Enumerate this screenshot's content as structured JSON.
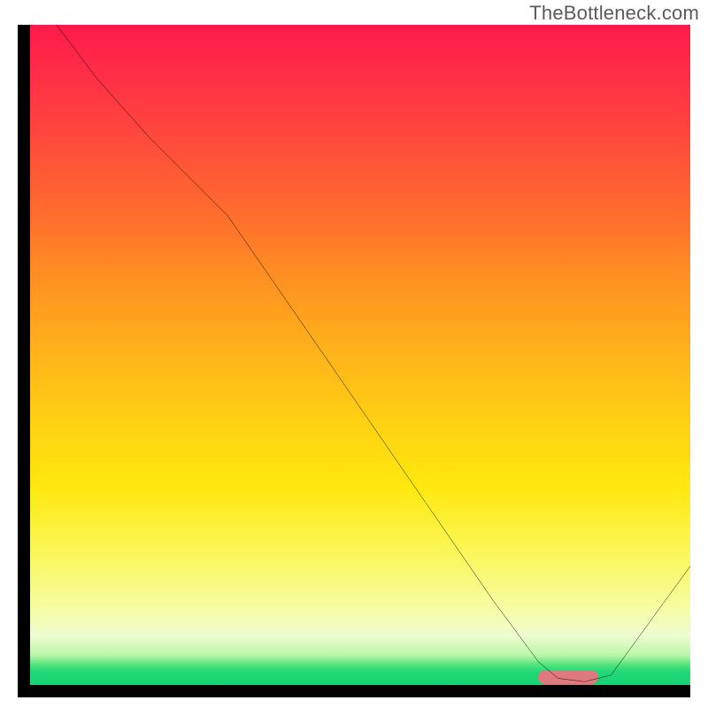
{
  "attribution": "TheBottleneck.com",
  "chart_data": {
    "type": "line",
    "title": "",
    "xlabel": "",
    "ylabel": "",
    "xlim": [
      0,
      100
    ],
    "ylim": [
      0,
      100
    ],
    "grid": false,
    "legend": false,
    "series": [
      {
        "name": "bottleneck-curve",
        "x": [
          4,
          10,
          18,
          27,
          30,
          40,
          50,
          60,
          70,
          77,
          80,
          84,
          88,
          100
        ],
        "y": [
          100,
          92,
          83,
          74,
          71,
          56.5,
          42,
          27.5,
          13,
          3.5,
          1,
          0.5,
          1.5,
          18
        ]
      }
    ],
    "marker": {
      "x_start": 77,
      "x_end": 86,
      "y": 1.2,
      "color": "#de7a7f"
    },
    "gradient_stops": [
      {
        "pos": 0,
        "color": "#ff1a4b"
      },
      {
        "pos": 50,
        "color": "#ffb41a"
      },
      {
        "pos": 80,
        "color": "#faf75a"
      },
      {
        "pos": 97,
        "color": "#4de27a"
      },
      {
        "pos": 100,
        "color": "#17d373"
      }
    ]
  }
}
